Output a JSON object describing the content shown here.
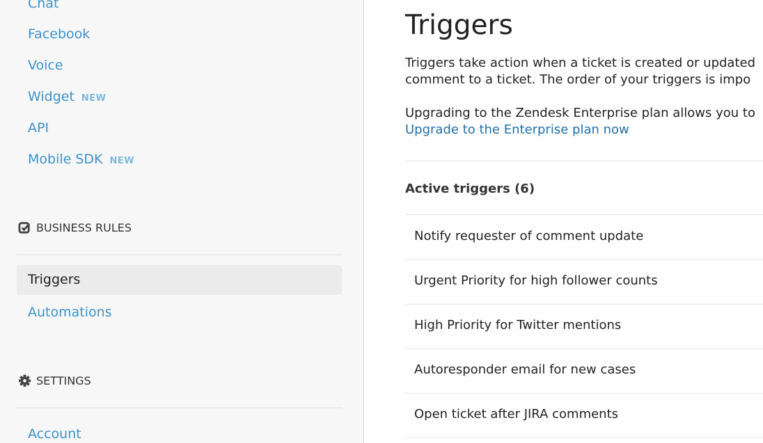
{
  "sidebar": {
    "channels": [
      {
        "label": "Chat"
      },
      {
        "label": "Facebook"
      },
      {
        "label": "Voice"
      },
      {
        "label": "Widget",
        "badge": "NEW"
      },
      {
        "label": "API"
      },
      {
        "label": "Mobile SDK",
        "badge": "NEW"
      }
    ],
    "business_rules": {
      "title": "BUSINESS RULES",
      "icon": "checkbox-icon",
      "items": [
        {
          "label": "Triggers",
          "selected": true
        },
        {
          "label": "Automations"
        }
      ]
    },
    "settings": {
      "title": "SETTINGS",
      "icon": "gear-icon",
      "items": [
        {
          "label": "Account"
        }
      ]
    }
  },
  "main": {
    "title": "Triggers",
    "description_line1": "Triggers take action when a ticket is created or updated",
    "description_line2": "comment to a ticket. The order of your triggers is impo",
    "upgrade_text": "Upgrading to the Zendesk Enterprise plan allows you to",
    "upgrade_link": "Upgrade to the Enterprise plan now",
    "active_heading": "Active triggers (6)",
    "triggers": [
      "Notify requester of comment update",
      "Urgent Priority for high follower counts",
      "High Priority for Twitter mentions",
      "Autoresponder email for new cases",
      "Open ticket after JIRA comments"
    ]
  },
  "colors": {
    "link": "#3d93c9",
    "sidebar_bg": "#f7f7f7",
    "selected_bg": "#ececec"
  }
}
